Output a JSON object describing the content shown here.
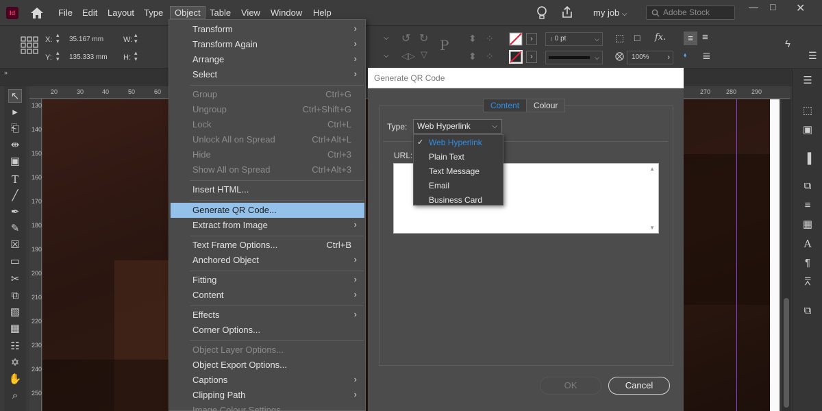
{
  "app": {
    "icon_text": "Id"
  },
  "menubar": {
    "items": [
      "File",
      "Edit",
      "Layout",
      "Type",
      "Object",
      "Table",
      "View",
      "Window",
      "Help"
    ],
    "job": "my job",
    "stock_placeholder": "Adobe Stock"
  },
  "controlbar": {
    "x_label": "X:",
    "x_value": "35.167 mm",
    "y_label": "Y:",
    "y_value": "135.333 mm",
    "w_label": "W:",
    "h_label": "H:",
    "stroke_weight": "0 pt",
    "opacity": "100%"
  },
  "ruler": {
    "h_left": [
      "20",
      "30",
      "40",
      "50",
      "60"
    ],
    "h_right": [
      "270",
      "280",
      "290"
    ],
    "v": [
      "130",
      "140",
      "150",
      "160",
      "170",
      "180",
      "190",
      "200",
      "210",
      "220",
      "230",
      "240",
      "250"
    ]
  },
  "object_menu": {
    "items": [
      {
        "label": "Transform",
        "shortcut": "",
        "submenu": true,
        "disabled": false
      },
      {
        "label": "Transform Again",
        "shortcut": "",
        "submenu": true,
        "disabled": false
      },
      {
        "label": "Arrange",
        "shortcut": "",
        "submenu": true,
        "disabled": false
      },
      {
        "label": "Select",
        "shortcut": "",
        "submenu": true,
        "disabled": false
      },
      {
        "label": "Group",
        "shortcut": "Ctrl+G",
        "submenu": false,
        "disabled": true
      },
      {
        "label": "Ungroup",
        "shortcut": "Ctrl+Shift+G",
        "submenu": false,
        "disabled": true
      },
      {
        "label": "Lock",
        "shortcut": "Ctrl+L",
        "submenu": false,
        "disabled": true
      },
      {
        "label": "Unlock All on Spread",
        "shortcut": "Ctrl+Alt+L",
        "submenu": false,
        "disabled": true
      },
      {
        "label": "Hide",
        "shortcut": "Ctrl+3",
        "submenu": false,
        "disabled": true
      },
      {
        "label": "Show All on Spread",
        "shortcut": "Ctrl+Alt+3",
        "submenu": false,
        "disabled": true
      },
      {
        "label": "Insert HTML...",
        "shortcut": "",
        "submenu": false,
        "disabled": false
      },
      {
        "label": "Generate QR Code...",
        "shortcut": "",
        "submenu": false,
        "disabled": false
      },
      {
        "label": "Extract from Image",
        "shortcut": "",
        "submenu": true,
        "disabled": false
      },
      {
        "label": "Text Frame Options...",
        "shortcut": "Ctrl+B",
        "submenu": false,
        "disabled": false
      },
      {
        "label": "Anchored Object",
        "shortcut": "",
        "submenu": true,
        "disabled": false
      },
      {
        "label": "Fitting",
        "shortcut": "",
        "submenu": true,
        "disabled": false
      },
      {
        "label": "Content",
        "shortcut": "",
        "submenu": true,
        "disabled": false
      },
      {
        "label": "Effects",
        "shortcut": "",
        "submenu": true,
        "disabled": false
      },
      {
        "label": "Corner Options...",
        "shortcut": "",
        "submenu": false,
        "disabled": false
      },
      {
        "label": "Object Layer Options...",
        "shortcut": "",
        "submenu": false,
        "disabled": true
      },
      {
        "label": "Object Export Options...",
        "shortcut": "",
        "submenu": false,
        "disabled": false
      },
      {
        "label": "Captions",
        "shortcut": "",
        "submenu": true,
        "disabled": false
      },
      {
        "label": "Clipping Path",
        "shortcut": "",
        "submenu": true,
        "disabled": false
      },
      {
        "label": "Image Colour Settings...",
        "shortcut": "",
        "submenu": false,
        "disabled": true
      }
    ]
  },
  "dialog": {
    "title": "Generate QR Code",
    "tabs": [
      "Content",
      "Colour"
    ],
    "type_label": "Type:",
    "type_value": "Web Hyperlink",
    "url_label": "URL:",
    "ok_label": "OK",
    "cancel_label": "Cancel"
  },
  "dropdown": {
    "options": [
      "Web Hyperlink",
      "Plain Text",
      "Text Message",
      "Email",
      "Business Card"
    ],
    "selected": "Web Hyperlink"
  },
  "colors": {
    "accent_blue": "#2f8fe9",
    "highlight": "#93c1ea",
    "guide": "#8e3de0"
  }
}
